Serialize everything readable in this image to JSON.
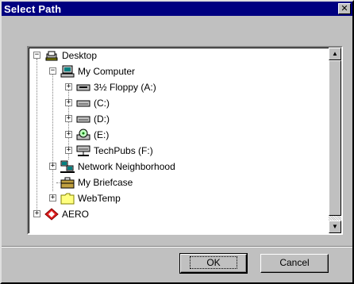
{
  "window": {
    "title": "Select Path",
    "close_glyph": "✕"
  },
  "tree": {
    "nodes": [
      {
        "label": "Desktop",
        "icon": "desktop-icon",
        "expander": "−"
      },
      {
        "label": "My Computer",
        "icon": "computer-icon",
        "expander": "−"
      },
      {
        "label": "3½ Floppy (A:)",
        "icon": "floppy-drive-icon",
        "expander": "+"
      },
      {
        "label": "(C:)",
        "icon": "hard-drive-icon",
        "expander": "+"
      },
      {
        "label": "(D:)",
        "icon": "hard-drive-icon",
        "expander": "+"
      },
      {
        "label": "(E:)",
        "icon": "cdrom-drive-icon",
        "expander": "+"
      },
      {
        "label": "TechPubs (F:)",
        "icon": "network-drive-icon",
        "expander": "+"
      },
      {
        "label": "Network Neighborhood",
        "icon": "network-neighborhood-icon",
        "expander": "+"
      },
      {
        "label": "My Briefcase",
        "icon": "briefcase-icon",
        "expander": ""
      },
      {
        "label": "WebTemp",
        "icon": "folder-icon",
        "expander": "+"
      },
      {
        "label": "AERO",
        "icon": "aero-icon",
        "expander": "+"
      }
    ]
  },
  "scrollbar": {
    "up_glyph": "▲",
    "down_glyph": "▼"
  },
  "buttons": {
    "ok": "OK",
    "cancel": "Cancel"
  },
  "colors": {
    "titlebar": "#000080",
    "face": "#c0c0c0"
  }
}
